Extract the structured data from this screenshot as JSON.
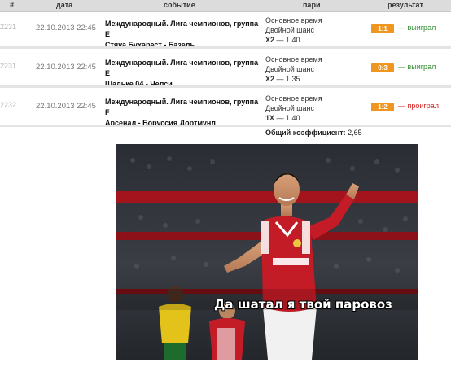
{
  "table": {
    "headers": {
      "num": "#",
      "date": "дата",
      "event": "событие",
      "bet": "пари",
      "result": "результат"
    },
    "rows": [
      {
        "id": "2231",
        "date": "22.10.2013 22:45",
        "event_line1": "Международный. Лига чемпионов, группа E",
        "event_line2": "Стяуа Бухарест - Базель",
        "bet_time": "Основное время",
        "bet_type": "Двойной шанс",
        "odds_pick": "X2",
        "odds_value": "— 1,40",
        "score": "1:1",
        "result": "— выиграл"
      },
      {
        "id": "2231",
        "date": "22.10.2013 22:45",
        "event_line1": "Международный. Лига чемпионов, группа E",
        "event_line2": "Шальке 04 - Челси",
        "bet_time": "Основное время",
        "bet_type": "Двойной шанс",
        "odds_pick": "X2",
        "odds_value": "— 1,35",
        "score": "0:3",
        "result": "— выиграл"
      },
      {
        "id": "2232",
        "date": "22.10.2013 22:45",
        "event_line1": "Международный. Лига чемпионов, группа F",
        "event_line2": "Арсенал - Боруссия Дортмунд",
        "bet_time": "Основное время",
        "bet_type": "Двойной шанс",
        "odds_pick": "1X",
        "odds_value": "— 1,40",
        "score": "1:2",
        "result": "— проиграл"
      }
    ]
  },
  "total": {
    "label": "Общий коэффициент:",
    "value": "2,65"
  },
  "photo": {
    "caption": "Да шатал я твой паровоз"
  },
  "colors": {
    "win": "#2e8b2e",
    "lose": "#d62020",
    "score_badge": "#f0961e",
    "arsenal_red": "#d21a24"
  }
}
